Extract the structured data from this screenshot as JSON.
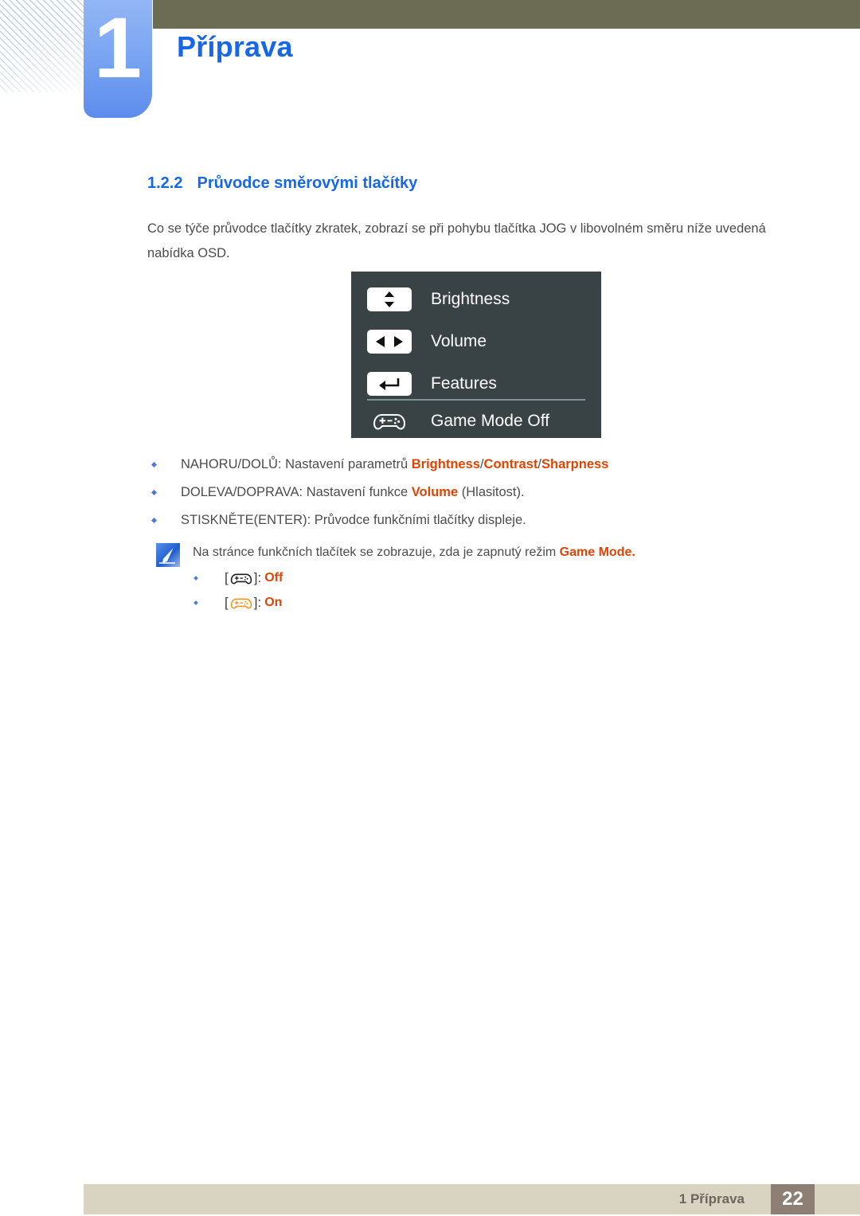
{
  "header": {
    "chapter_number": "1",
    "chapter_title": "Příprava",
    "olive_bar_color": "#6c6b54",
    "tab_color": "#7ba6f2",
    "title_color": "#1668e8"
  },
  "section": {
    "number": "1.2.2",
    "title": "Průvodce směrovými tlačítky",
    "intro": "Co se týče průvodce tlačítky zkratek, zobrazí se při pohybu tlačítka JOG v libovolném směru níže uvedená nabídka OSD."
  },
  "osd": {
    "background_color": "#394244",
    "rows": [
      {
        "icon": "up-down-arrows-icon",
        "label": "Brightness"
      },
      {
        "icon": "left-right-arrows-icon",
        "label": "Volume"
      },
      {
        "icon": "enter-arrow-icon",
        "label": "Features"
      },
      {
        "icon": "gamepad-icon",
        "label": "Game Mode Off"
      }
    ]
  },
  "bullets": [
    {
      "prefix": "NAHORU/DOLŮ: Nastavení parametrů ",
      "highlights": [
        "Brightness",
        "Contrast",
        "Sharpness"
      ],
      "separator": "/",
      "suffix": ""
    },
    {
      "prefix": "DOLEVA/DOPRAVA: Nastavení funkce ",
      "highlights": [
        "Volume"
      ],
      "separator": "/",
      "suffix": " (Hlasitost)."
    },
    {
      "prefix": "STISKNĚTE(ENTER): Průvodce funkčními tlačítky displeje.",
      "highlights": [],
      "separator": "/",
      "suffix": ""
    }
  ],
  "note": {
    "icon": "note-pen-icon",
    "text_prefix": "Na stránce funkčních tlačítek se zobrazuje, zda je zapnutý režim ",
    "text_highlight": "Game Mode.",
    "sub_items": [
      {
        "icon": "gamepad-icon-black",
        "bracket_open": "[",
        "bracket_close": "]:",
        "state": "Off"
      },
      {
        "icon": "gamepad-icon-orange",
        "bracket_open": "[",
        "bracket_close": "]:",
        "state": "On"
      }
    ]
  },
  "footer": {
    "label": "1 Příprava",
    "page_number": "22",
    "bar_color": "#d9d4c2",
    "page_box_color": "#8d7f74"
  },
  "colors": {
    "accent_blue": "#1668e8",
    "highlight_orange": "#e04403",
    "body_text": "#4c4c4c"
  }
}
